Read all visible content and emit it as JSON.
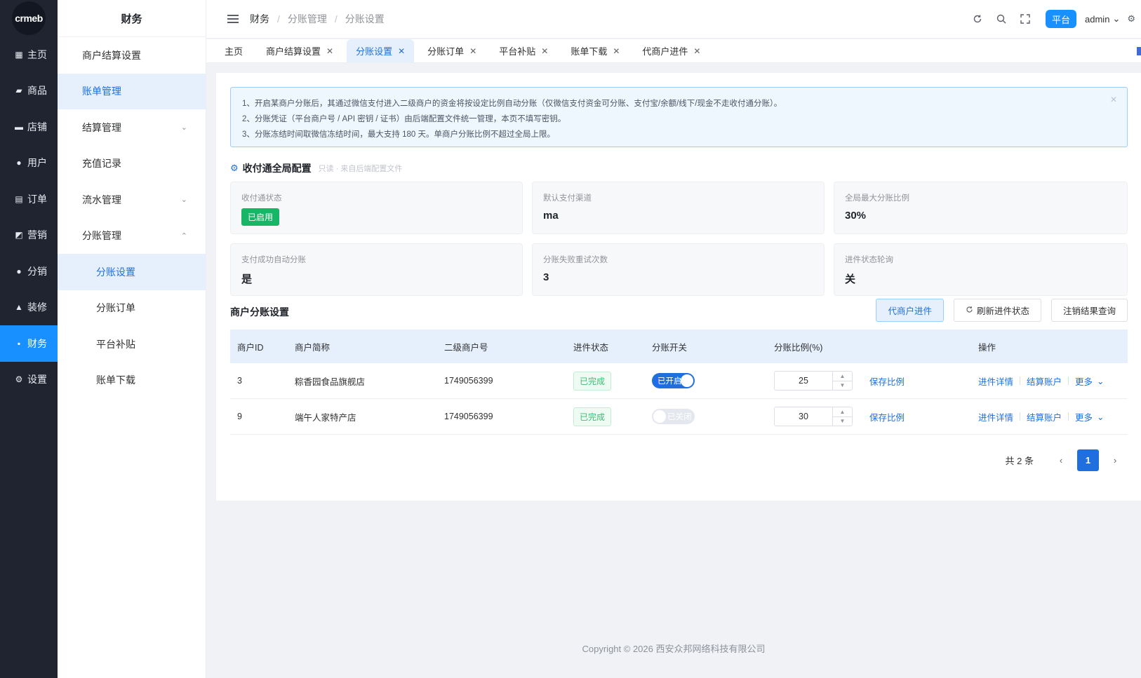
{
  "rail": {
    "logo": "crmeb",
    "items": [
      {
        "label": "主页",
        "icon": "grid-icon",
        "glyph": "▦"
      },
      {
        "label": "商品",
        "icon": "bag-icon",
        "glyph": "▰"
      },
      {
        "label": "店铺",
        "icon": "store-icon",
        "glyph": "▬"
      },
      {
        "label": "用户",
        "icon": "user-icon",
        "glyph": "●"
      },
      {
        "label": "订单",
        "icon": "order-icon",
        "glyph": "▤"
      },
      {
        "label": "营销",
        "icon": "chart-icon",
        "glyph": "◩"
      },
      {
        "label": "分销",
        "icon": "distribution-icon",
        "glyph": "●"
      },
      {
        "label": "装修",
        "icon": "home-icon",
        "glyph": "▲"
      },
      {
        "label": "财务",
        "icon": "finance-icon",
        "glyph": "▪",
        "active": true
      },
      {
        "label": "设置",
        "icon": "gear-icon",
        "glyph": "⚙"
      }
    ]
  },
  "subnav": {
    "title": "财务",
    "items": [
      {
        "label": "商户结算设置"
      },
      {
        "label": "账单管理",
        "active": true
      },
      {
        "label": "结算管理",
        "chevron": "⌄"
      },
      {
        "label": "充值记录"
      },
      {
        "label": "流水管理",
        "chevron": "⌄"
      },
      {
        "label": "分账管理",
        "chevron": "⌃"
      },
      {
        "label": "分账设置",
        "child": true,
        "active": true
      },
      {
        "label": "分账订单",
        "child": true
      },
      {
        "label": "平台补贴",
        "child": true
      },
      {
        "label": "账单下载",
        "child": true
      }
    ]
  },
  "header": {
    "breadcrumb": [
      "财务",
      "分账管理",
      "分账设置"
    ],
    "platform_label": "平台",
    "user": "admin"
  },
  "tabs": [
    {
      "label": "主页",
      "closable": false
    },
    {
      "label": "商户结算设置",
      "closable": true
    },
    {
      "label": "分账设置",
      "closable": true,
      "active": true
    },
    {
      "label": "分账订单",
      "closable": true
    },
    {
      "label": "平台补贴",
      "closable": true
    },
    {
      "label": "账单下载",
      "closable": true
    },
    {
      "label": "代商户进件",
      "closable": true
    }
  ],
  "alert": {
    "lines": [
      "1、开启某商户分账后，其通过微信支付进入二级商户的资金将按设定比例自动分账（仅微信支付资金可分账、支付宝/余额/线下/现金不走收付通分账）。",
      "2、分账凭证（平台商户号 / API 密钥 / 证书）由后端配置文件统一管理，本页不填写密钥。",
      "3、分账冻结时间取微信冻结时间，最大支持 180 天。单商户分账比例不超过全局上限。"
    ]
  },
  "global_config": {
    "title": "收付通全局配置",
    "hint": "只读 · 来自后端配置文件",
    "cells": [
      {
        "label": "收付通状态",
        "value": "已启用",
        "tag": true
      },
      {
        "label": "默认支付渠道",
        "value": "ma"
      },
      {
        "label": "全局最大分账比例",
        "value": "30%"
      },
      {
        "label": "支付成功自动分账",
        "value": "是"
      },
      {
        "label": "分账失败重试次数",
        "value": "3"
      },
      {
        "label": "进件状态轮询",
        "value": "关"
      }
    ]
  },
  "merchant_section": {
    "title": "商户分账设置",
    "buttons": {
      "onboard": "代商户进件",
      "refresh": "刷新进件状态",
      "cancel_query": "注销结果查询"
    }
  },
  "table": {
    "headers": [
      "商户ID",
      "商户简称",
      "二级商户号",
      "进件状态",
      "分账开关",
      "分账比例(%)",
      "操作"
    ],
    "rows": [
      {
        "id": "3",
        "name": "粽香园食品旗舰店",
        "sub_mch": "1749056399",
        "status": "已完成",
        "switch_label": "已开启",
        "switch_on": true,
        "ratio": "25",
        "save": "保存比例",
        "detail": "进件详情",
        "account": "结算账户",
        "more": "更多"
      },
      {
        "id": "9",
        "name": "端午人家特产店",
        "sub_mch": "1749056399",
        "status": "已完成",
        "switch_label": "已关闭",
        "switch_on": false,
        "ratio": "30",
        "save": "保存比例",
        "detail": "进件详情",
        "account": "结算账户",
        "more": "更多"
      }
    ]
  },
  "pagination": {
    "total": "共 2 条",
    "current": "1"
  },
  "footer": "Copyright © 2026 西安众邦网络科技有限公司"
}
